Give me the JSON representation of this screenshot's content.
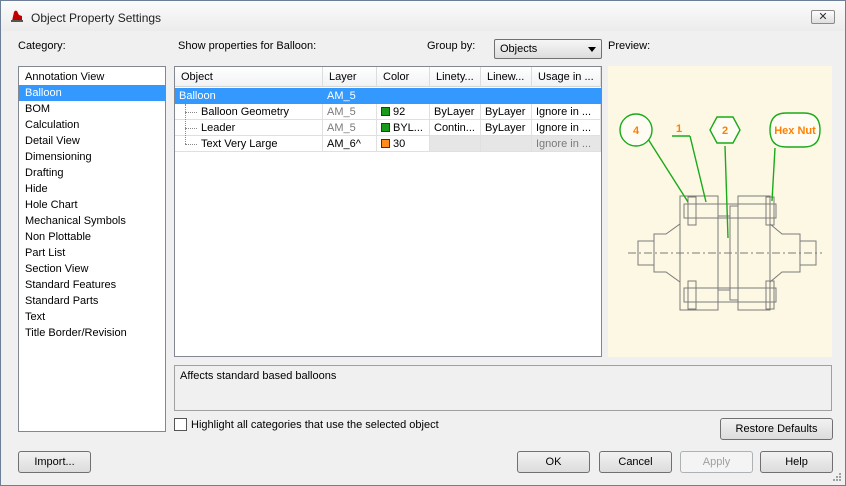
{
  "window": {
    "title": "Object Property Settings",
    "close_label": "✕"
  },
  "labels": {
    "category": "Category:",
    "show_props": "Show properties for Balloon:",
    "group_by": "Group by:",
    "preview": "Preview:"
  },
  "group_by": {
    "selected": "Objects"
  },
  "categories": [
    "Annotation View",
    "Balloon",
    "BOM",
    "Calculation",
    "Detail View",
    "Dimensioning",
    "Drafting",
    "Hide",
    "Hole Chart",
    "Mechanical Symbols",
    "Non Plottable",
    "Part List",
    "Section View",
    "Standard Features",
    "Standard Parts",
    "Text",
    "Title Border/Revision"
  ],
  "selected_category": "Balloon",
  "grid": {
    "headers": [
      "Object",
      "Layer",
      "Color",
      "Linety...",
      "Linew...",
      "Usage in ..."
    ],
    "rows": [
      {
        "object": "Balloon",
        "layer": "AM_5",
        "color": "",
        "linetype": "",
        "lineweight": "",
        "usage": ""
      },
      {
        "object": "Balloon Geometry",
        "layer": "AM_5",
        "color": "92",
        "linetype": "ByLayer",
        "lineweight": "ByLayer",
        "usage": "Ignore in ..."
      },
      {
        "object": "Leader",
        "layer": "AM_5",
        "color": "BYL...",
        "linetype": "Contin...",
        "lineweight": "ByLayer",
        "usage": "Ignore in ..."
      },
      {
        "object": "Text Very Large",
        "layer": "AM_6^",
        "color": "30",
        "linetype": "",
        "lineweight": "",
        "usage": "Ignore in ..."
      }
    ],
    "swatch_colors": [
      "#1a9a1a",
      "#1a9a1a",
      "#ff8c1a"
    ]
  },
  "preview": {
    "balloons": [
      "4",
      "1",
      "2",
      "Hex Nut"
    ],
    "balloon_color": "#ff7f00",
    "outline_color": "#1aaa1a"
  },
  "description": "Affects standard based balloons",
  "highlight_checkbox": {
    "label": "Highlight all categories that use the selected object",
    "checked": false
  },
  "buttons": {
    "restore": "Restore Defaults",
    "import": "Import...",
    "ok": "OK",
    "cancel": "Cancel",
    "apply": "Apply",
    "help": "Help"
  }
}
